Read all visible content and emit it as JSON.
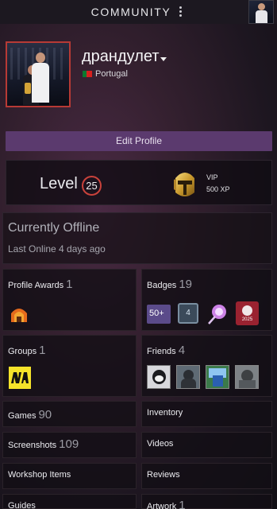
{
  "topbar": {
    "title": "COMMUNITY",
    "menu_icon": "kebab-menu-icon",
    "avatar_icon": "user-avatar-icon"
  },
  "profile": {
    "username": "драндулет",
    "country": "Portugal",
    "flag": "portugal-flag-icon",
    "edit_label": "Edit Profile",
    "accent_color": "#c9423b",
    "button_color": "#5b3a6e"
  },
  "level": {
    "label": "Level",
    "value": "25",
    "badge_line1": "VIP",
    "badge_line2": "500 XP",
    "badge_icon": "gold-helmet-icon"
  },
  "status": {
    "title": "Currently Offline",
    "last_online": "Last Online 4 days ago"
  },
  "sections": {
    "profile_awards": {
      "label": "Profile Awards",
      "count": "1",
      "icon": "award-icon"
    },
    "badges": {
      "label": "Badges",
      "count": "19",
      "items": [
        "50+",
        "4",
        "",
        "2025"
      ]
    },
    "groups": {
      "label": "Groups",
      "count": "1",
      "icon": "navi-group-icon"
    },
    "friends": {
      "label": "Friends",
      "count": "4"
    },
    "games": {
      "label": "Games",
      "count": "90"
    },
    "inventory": {
      "label": "Inventory"
    },
    "screenshots": {
      "label": "Screenshots",
      "count": "109"
    },
    "videos": {
      "label": "Videos"
    },
    "workshop": {
      "label": "Workshop Items"
    },
    "reviews": {
      "label": "Reviews"
    },
    "guides": {
      "label": "Guides"
    },
    "artwork": {
      "label": "Artwork",
      "count": "1"
    }
  }
}
